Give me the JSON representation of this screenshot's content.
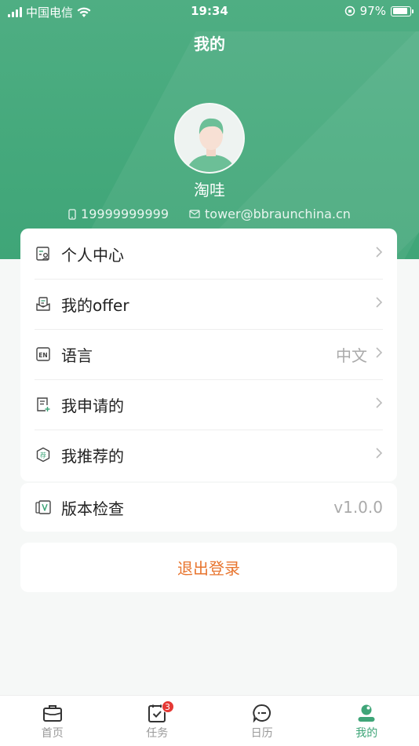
{
  "status_bar": {
    "carrier": "中国电信",
    "time": "19:34",
    "battery": "97%"
  },
  "header": {
    "title": "我的"
  },
  "profile": {
    "name": "淘哇",
    "phone": "19999999999",
    "email": "tower@bbraunchina.cn"
  },
  "menu": {
    "items": [
      {
        "label": "个人中心",
        "icon": "profile-card-icon"
      },
      {
        "label": "我的offer",
        "icon": "offer-icon"
      },
      {
        "label": "语言",
        "value": "中文",
        "icon": "language-en-icon"
      },
      {
        "label": "我申请的",
        "icon": "apply-doc-icon"
      },
      {
        "label": "我推荐的",
        "icon": "recommend-icon"
      }
    ]
  },
  "version": {
    "label": "版本检查",
    "value": "v1.0.0"
  },
  "logout": {
    "label": "退出登录"
  },
  "tabbar": {
    "tabs": [
      {
        "label": "首页",
        "icon": "briefcase-icon"
      },
      {
        "label": "任务",
        "icon": "task-clipboard-icon",
        "badge": "3"
      },
      {
        "label": "日历",
        "icon": "chat-bubble-icon"
      },
      {
        "label": "我的",
        "icon": "profile-icon",
        "active": true
      }
    ]
  },
  "colors": {
    "brand_green": "#4fae83",
    "logout_orange": "#e8752f",
    "badge_red": "#e53935"
  }
}
